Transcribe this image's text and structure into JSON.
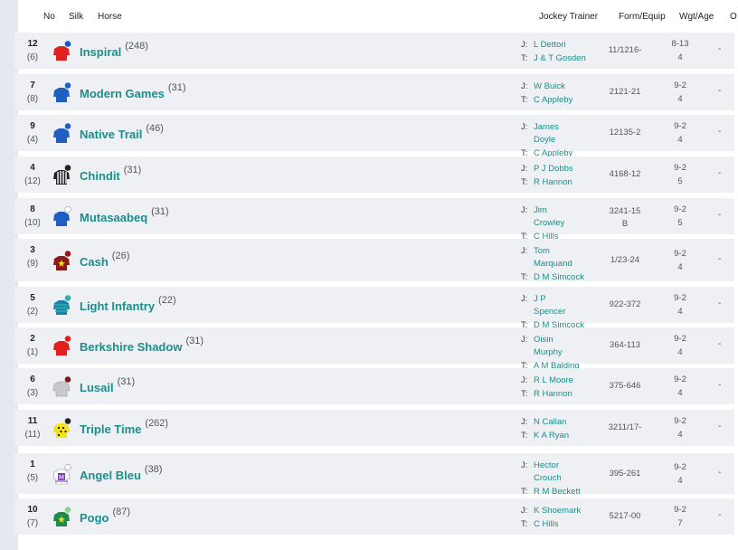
{
  "headers": {
    "no": "No",
    "silk": "Silk",
    "horse": "Horse",
    "jockey_trainer": "Jockey Trainer",
    "form": "Form/Equip",
    "wgt_age": "Wgt/Age",
    "odds": "O"
  },
  "prefix": {
    "jockey": "J:",
    "trainer": "T:"
  },
  "runners": [
    {
      "no": "12",
      "draw": "(6)",
      "name": "Inspiral",
      "days": "(248)",
      "jockey": "L Dettori",
      "trainer": "J & T Gosden",
      "form": "11/1216-",
      "equip": "",
      "wgt": "8-13",
      "age": "4",
      "dash": "-",
      "silk": {
        "body": "#e0201f",
        "cap": "#1556c9",
        "pattern": "sash"
      }
    },
    {
      "no": "7",
      "draw": "(8)",
      "name": "Modern Games",
      "days": "(31)",
      "jockey": "W Buick",
      "trainer": "C Appleby",
      "form": "2121-21",
      "equip": "",
      "wgt": "9-2",
      "age": "4",
      "dash": "-",
      "silk": {
        "body": "#1f5fc2",
        "cap": "#1f5fc2",
        "pattern": "plain"
      }
    },
    {
      "no": "9",
      "draw": "(4)",
      "name": "Native Trail",
      "days": "(46)",
      "jockey": "James Doyle",
      "trainer": "C Appleby",
      "form": "12135-2",
      "equip": "",
      "wgt": "9-2",
      "age": "4",
      "dash": "-",
      "silk": {
        "body": "#1f5fc2",
        "cap": "#1f5fc2",
        "pattern": "plain"
      }
    },
    {
      "no": "4",
      "draw": "(12)",
      "name": "Chindit",
      "days": "(31)",
      "jockey": "P J Dobbs",
      "trainer": "R Hannon",
      "form": "4168-12",
      "equip": "",
      "wgt": "9-2",
      "age": "5",
      "dash": "-",
      "silk": {
        "body": "#222222",
        "cap": "#222222",
        "pattern": "stripes"
      }
    },
    {
      "no": "8",
      "draw": "(10)",
      "name": "Mutasaabeq",
      "days": "(31)",
      "jockey": "Jim Crowley",
      "trainer": "C Hills",
      "form": "3241-15",
      "equip": "B",
      "wgt": "9-2",
      "age": "5",
      "dash": "-",
      "silk": {
        "body": "#1f5fc2",
        "cap": "#ffffff",
        "pattern": "plain"
      }
    },
    {
      "no": "3",
      "draw": "(9)",
      "name": "Cash",
      "days": "(26)",
      "jockey": "Tom Marquand",
      "trainer": "D M Simcock",
      "form": "1/23-24",
      "equip": "",
      "wgt": "9-2",
      "age": "4",
      "dash": "-",
      "silk": {
        "body": "#8b1a1a",
        "cap": "#8b1a1a",
        "pattern": "star"
      }
    },
    {
      "no": "5",
      "draw": "(2)",
      "name": "Light Infantry",
      "days": "(22)",
      "jockey": "J P Spencer",
      "trainer": "D M Simcock",
      "form": "922-372",
      "equip": "",
      "wgt": "9-2",
      "age": "4",
      "dash": "-",
      "silk": {
        "body": "#1a7fb0",
        "cap": "#2bb3a3",
        "pattern": "hoops"
      }
    },
    {
      "no": "2",
      "draw": "(1)",
      "name": "Berkshire Shadow",
      "days": "(31)",
      "jockey": "Oisin Murphy",
      "trainer": "A M Balding",
      "form": "364-113",
      "equip": "",
      "wgt": "9-2",
      "age": "4",
      "dash": "-",
      "silk": {
        "body": "#e0201f",
        "cap": "#e0201f",
        "pattern": "plain"
      }
    },
    {
      "no": "6",
      "draw": "(3)",
      "name": "Lusail",
      "days": "(31)",
      "jockey": "R L Moore",
      "trainer": "R Hannon",
      "form": "375-646",
      "equip": "",
      "wgt": "9-2",
      "age": "4",
      "dash": "-",
      "silk": {
        "body": "#c8c8c8",
        "cap": "#7a1a1a",
        "pattern": "plain"
      }
    },
    {
      "no": "11",
      "draw": "(11)",
      "name": "Triple Time",
      "days": "(262)",
      "jockey": "N Callan",
      "trainer": "K A Ryan",
      "form": "3211/17-",
      "equip": "",
      "wgt": "9-2",
      "age": "4",
      "dash": "-",
      "silk": {
        "body": "#f2e316",
        "cap": "#222222",
        "pattern": "dots"
      }
    },
    {
      "no": "1",
      "draw": "(5)",
      "name": "Angel Bleu",
      "days": "(38)",
      "jockey": "Hector Crouch",
      "trainer": "R M Beckett",
      "form": "395-261",
      "equip": "",
      "wgt": "9-2",
      "age": "4",
      "dash": "-",
      "silk": {
        "body": "#ffffff",
        "cap": "#ffffff",
        "pattern": "letter"
      }
    },
    {
      "no": "10",
      "draw": "(7)",
      "name": "Pogo",
      "days": "(87)",
      "jockey": "K Shoemark",
      "trainer": "C Hills",
      "form": "5217-00",
      "equip": "",
      "wgt": "9-2",
      "age": "7",
      "dash": "-",
      "silk": {
        "body": "#1f8a4a",
        "cap": "#8fd18f",
        "pattern": "star"
      }
    }
  ]
}
